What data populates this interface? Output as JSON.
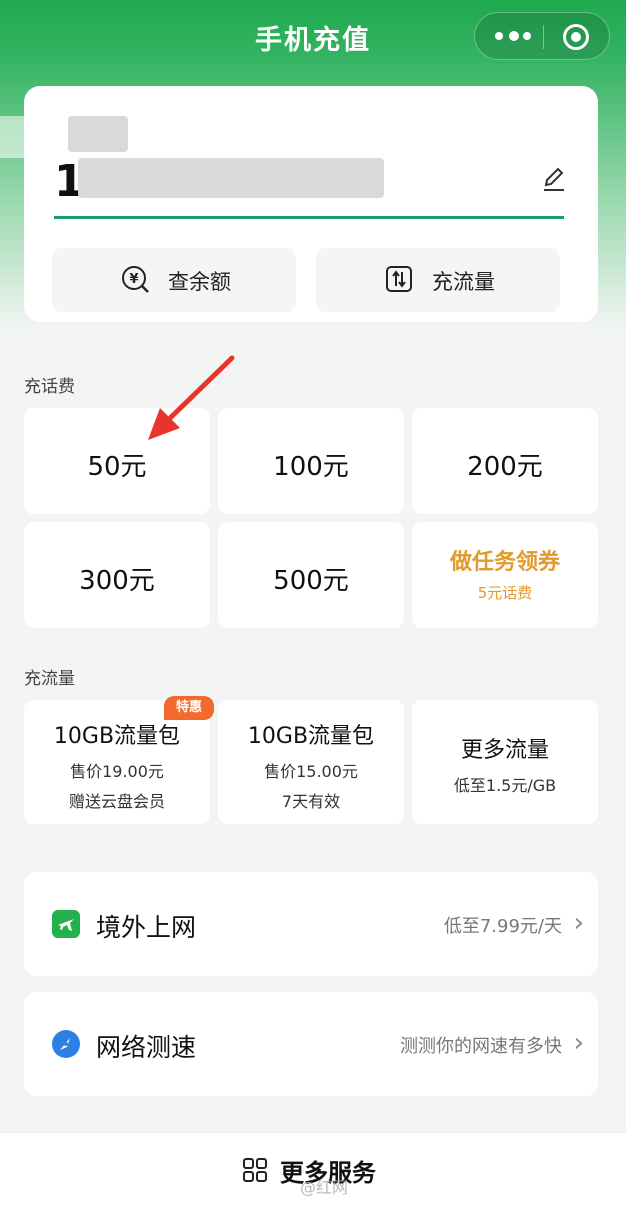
{
  "header": {
    "title": "手机充值"
  },
  "account": {
    "phone_prefix": "1"
  },
  "actions": {
    "balance": "查余额",
    "data": "充流量"
  },
  "phone_fee": {
    "section_label": "充话费",
    "amounts": [
      "50元",
      "100元",
      "200元",
      "300元",
      "500元"
    ],
    "task": {
      "title": "做任务领券",
      "sub": "5元话费"
    }
  },
  "data_plans": {
    "section_label": "充流量",
    "badge": "特惠",
    "plans": [
      {
        "title": "10GB流量包",
        "price": "售价19.00元",
        "note": "赠送云盘会员"
      },
      {
        "title": "10GB流量包",
        "price": "售价15.00元",
        "note": "7天有效"
      },
      {
        "title": "更多流量",
        "price": "低至1.5元/GB",
        "note": ""
      }
    ]
  },
  "services": [
    {
      "label": "境外上网",
      "sub": "低至7.99元/天",
      "icon": "plane-icon"
    },
    {
      "label": "网络测速",
      "sub": "测测你的网速有多快",
      "icon": "speed-icon"
    }
  ],
  "bottom": {
    "label": "更多服务"
  },
  "watermark": "@红网",
  "colors": {
    "primary": "#1ea94f",
    "accent": "#e29a2c",
    "badge": "#f26a2e"
  }
}
